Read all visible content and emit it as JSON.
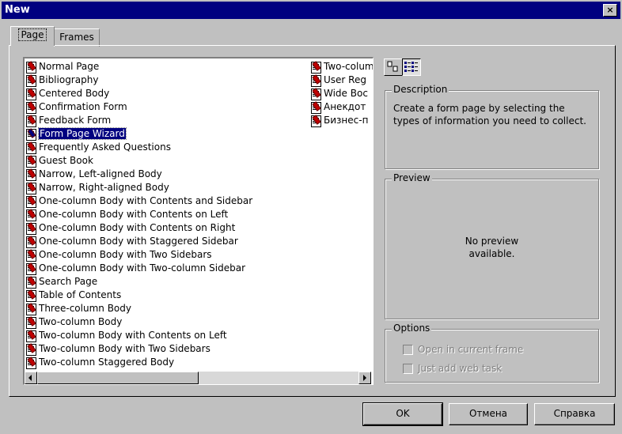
{
  "window": {
    "title": "New",
    "close_label": "×"
  },
  "tabs": [
    {
      "label": "Page"
    },
    {
      "label": "Frames"
    }
  ],
  "templates_left": [
    "Normal Page",
    "Bibliography",
    "Centered Body",
    "Confirmation Form",
    "Feedback Form",
    "Form Page Wizard",
    "Frequently Asked Questions",
    "Guest Book",
    "Narrow, Left-aligned Body",
    "Narrow, Right-aligned Body",
    "One-column Body with Contents and Sidebar",
    "One-column Body with Contents on Left",
    "One-column Body with Contents on Right",
    "One-column Body with Staggered Sidebar",
    "One-column Body with Two Sidebars",
    "One-column Body with Two-column Sidebar",
    "Search Page",
    "Table of Contents",
    "Three-column Body",
    "Two-column Body",
    "Two-column Body with Contents on Left",
    "Two-column Body with Two Sidebars",
    "Two-column Staggered Body"
  ],
  "templates_right": [
    "Two-colum",
    "User Reg",
    "Wide Boc",
    "Анекдот",
    "Бизнес-п"
  ],
  "selected_template": "Form Page Wizard",
  "description": {
    "title": "Description",
    "text": "Create a form page by selecting the types of information you need to collect."
  },
  "preview": {
    "title": "Preview",
    "text_line1": "No preview",
    "text_line2": "available."
  },
  "options": {
    "title": "Options",
    "open_in_current_frame": "Open in current frame",
    "just_add_web_task": "Just add web task"
  },
  "buttons": {
    "ok": "OK",
    "cancel": "Отмена",
    "help": "Справка"
  }
}
